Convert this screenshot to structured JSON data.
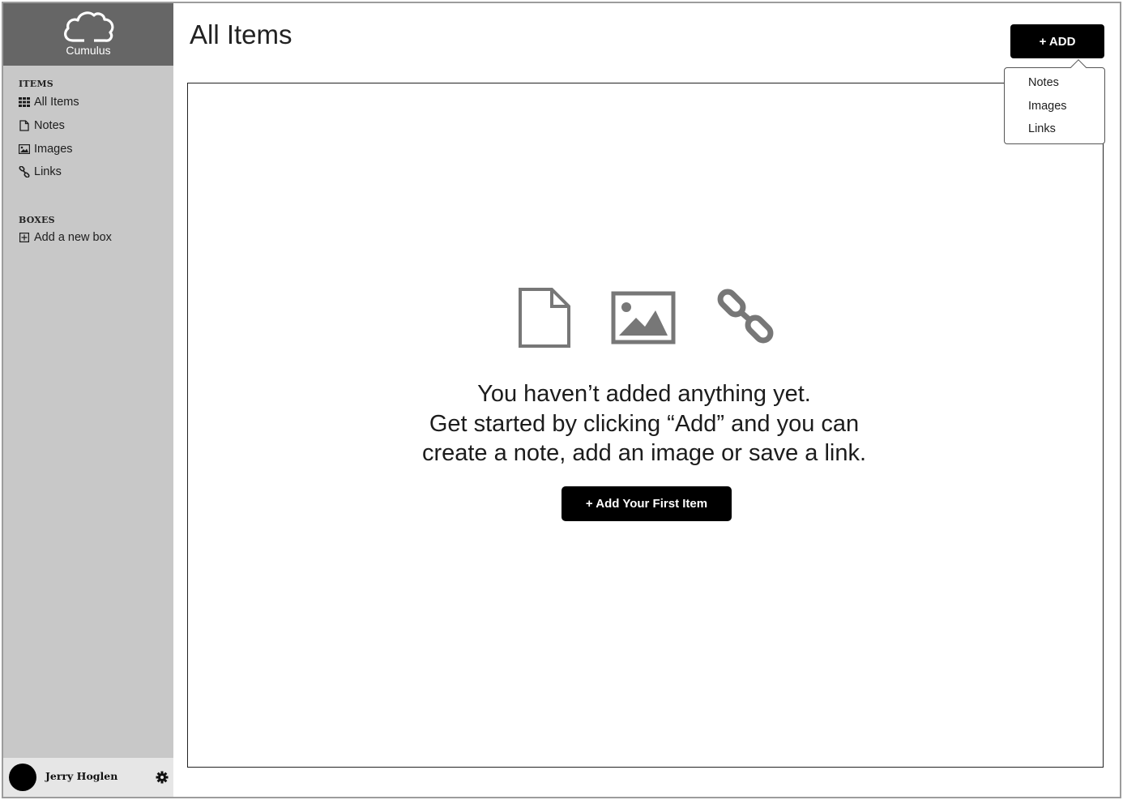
{
  "app": {
    "name": "Cumulus"
  },
  "sidebar": {
    "items_heading": "ITEMS",
    "items": [
      {
        "label": "All Items",
        "icon": "grid-icon"
      },
      {
        "label": "Notes",
        "icon": "document-icon"
      },
      {
        "label": "Images",
        "icon": "image-icon"
      },
      {
        "label": "Links",
        "icon": "link-icon"
      }
    ],
    "boxes_heading": "BOXES",
    "add_box_label": "Add a new box"
  },
  "user": {
    "name": "Jerry Hoglen"
  },
  "header": {
    "title": "All Items",
    "add_label": "+ ADD"
  },
  "add_menu": {
    "items": [
      "Notes",
      "Images",
      "Links"
    ]
  },
  "empty_state": {
    "line1": "You haven’t added anything yet.",
    "line2": "Get started by clicking “Add” and you can",
    "line3": "create a note, add an image or save a link.",
    "button_label": "+ Add Your First Item"
  },
  "colors": {
    "sidebar_bg": "#c8c8c8",
    "brand_bg": "#666666",
    "button_bg": "#000000",
    "icon_gray": "#777777"
  }
}
